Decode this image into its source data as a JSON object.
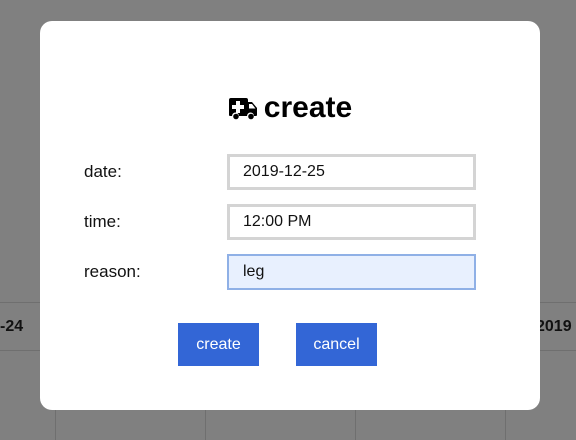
{
  "background": {
    "calendar_row_labels": [
      "-24",
      "2019"
    ]
  },
  "dialog": {
    "title": "create",
    "title_icon": "ambulance-icon",
    "fields": [
      {
        "label": "date:",
        "value": "2019-12-25"
      },
      {
        "label": "time:",
        "value": "12:00 PM"
      },
      {
        "label": "reason:",
        "value": "leg"
      }
    ],
    "buttons": {
      "create": "create",
      "cancel": "cancel"
    }
  },
  "colors": {
    "overlay": "#808080",
    "button": "#3366d6",
    "focused_input": "#e8f0fe"
  }
}
